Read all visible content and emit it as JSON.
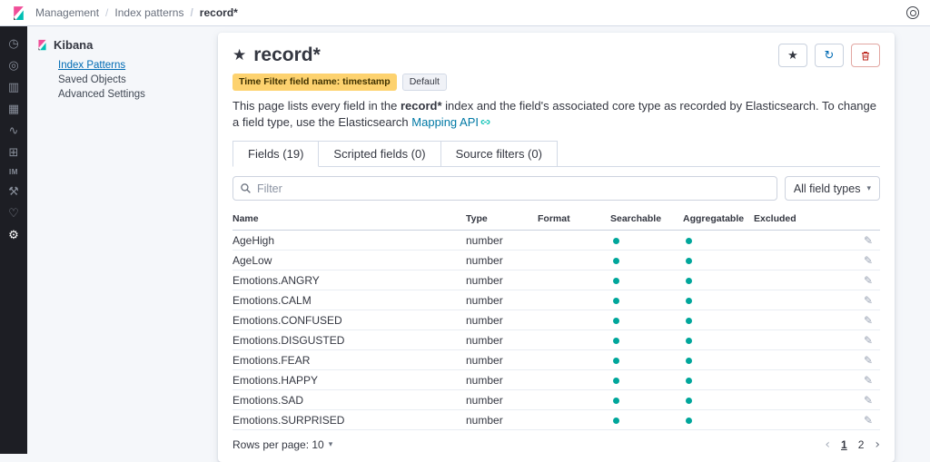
{
  "topbar": {
    "breadcrumb": [
      "Management",
      "Index patterns",
      "record*"
    ]
  },
  "nav": {
    "items": [
      {
        "name": "recently-viewed-icon",
        "glyph": "◷",
        "active": false
      },
      {
        "name": "discover-icon",
        "glyph": "◎",
        "active": false
      },
      {
        "name": "visualize-icon",
        "glyph": "▥",
        "active": false
      },
      {
        "name": "dashboard-icon",
        "glyph": "▦",
        "active": false
      },
      {
        "name": "timelion-icon",
        "glyph": "∿",
        "active": false
      },
      {
        "name": "maps-icon",
        "glyph": "⊞",
        "active": false
      },
      {
        "name": "index-management-icon",
        "glyph": "IM",
        "active": false
      },
      {
        "name": "dev-tools-icon",
        "glyph": "⚒",
        "active": false
      },
      {
        "name": "monitoring-icon",
        "glyph": "♡",
        "active": false
      },
      {
        "name": "management-icon",
        "glyph": "⚙",
        "active": true
      }
    ]
  },
  "sidebar": {
    "title": "Kibana",
    "items": [
      {
        "label": "Index Patterns",
        "active": true
      },
      {
        "label": "Saved Objects",
        "active": false
      },
      {
        "label": "Advanced Settings",
        "active": false
      }
    ]
  },
  "icons": {
    "star": "★",
    "refresh": "↻",
    "pencil": "✎",
    "prev_chevron": "‹",
    "next_chevron": "›"
  },
  "page": {
    "title": "record*",
    "badges": {
      "time_filter": "Time Filter field name: timestamp",
      "default_badge": "Default"
    },
    "description": {
      "pre": "This page lists every field in the ",
      "bold": "record*",
      "mid": " index and the field's associated core type as recorded by Elasticsearch. To change a field type, use the Elasticsearch ",
      "link": "Mapping API"
    },
    "tabs": [
      {
        "id": "fields",
        "label": "Fields (19)",
        "active": true
      },
      {
        "id": "scripted-fields",
        "label": "Scripted fields (0)",
        "active": false
      },
      {
        "id": "source-filters",
        "label": "Source filters (0)",
        "active": false
      }
    ],
    "filter": {
      "placeholder": "Filter"
    },
    "type_dropdown": "All field types",
    "table": {
      "headers": [
        "Name",
        "Type",
        "Format",
        "Searchable",
        "Aggregatable",
        "Excluded"
      ],
      "rows": [
        {
          "name": "AgeHigh",
          "type": "number",
          "format": "",
          "searchable": true,
          "aggregatable": true,
          "excluded": false
        },
        {
          "name": "AgeLow",
          "type": "number",
          "format": "",
          "searchable": true,
          "aggregatable": true,
          "excluded": false
        },
        {
          "name": "Emotions.ANGRY",
          "type": "number",
          "format": "",
          "searchable": true,
          "aggregatable": true,
          "excluded": false
        },
        {
          "name": "Emotions.CALM",
          "type": "number",
          "format": "",
          "searchable": true,
          "aggregatable": true,
          "excluded": false
        },
        {
          "name": "Emotions.CONFUSED",
          "type": "number",
          "format": "",
          "searchable": true,
          "aggregatable": true,
          "excluded": false
        },
        {
          "name": "Emotions.DISGUSTED",
          "type": "number",
          "format": "",
          "searchable": true,
          "aggregatable": true,
          "excluded": false
        },
        {
          "name": "Emotions.FEAR",
          "type": "number",
          "format": "",
          "searchable": true,
          "aggregatable": true,
          "excluded": false
        },
        {
          "name": "Emotions.HAPPY",
          "type": "number",
          "format": "",
          "searchable": true,
          "aggregatable": true,
          "excluded": false
        },
        {
          "name": "Emotions.SAD",
          "type": "number",
          "format": "",
          "searchable": true,
          "aggregatable": true,
          "excluded": false
        },
        {
          "name": "Emotions.SURPRISED",
          "type": "number",
          "format": "",
          "searchable": true,
          "aggregatable": true,
          "excluded": false
        }
      ]
    },
    "footer": {
      "rows_per_page": "Rows per page: 10",
      "pages": [
        "1",
        "2"
      ],
      "active_page": "1"
    }
  },
  "colors": {
    "brand_pink": "#f04e98",
    "brand_teal": "#00bfb3",
    "dot_teal": "#00a69b",
    "link_blue": "#0079a5",
    "badge_yellow": "#fdd26f",
    "danger_red": "#bd271e"
  }
}
